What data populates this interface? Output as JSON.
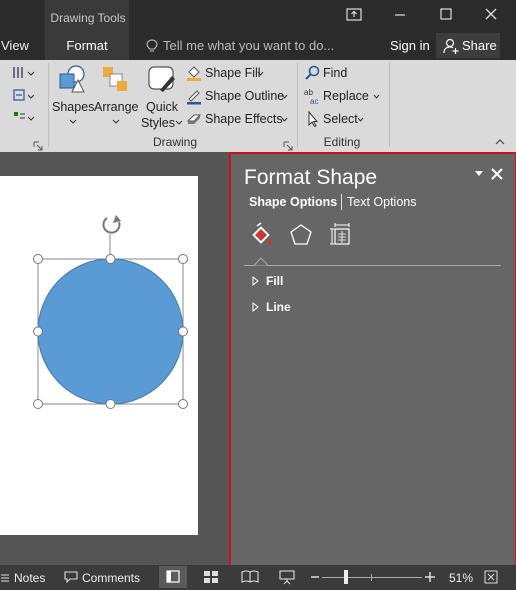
{
  "titlebar": {
    "context_label": "Drawing Tools",
    "tabs": [
      {
        "label": "View"
      },
      {
        "label": "Format"
      }
    ],
    "tell_me_placeholder": "Tell me what you want to do...",
    "sign_in": "Sign in",
    "share": "Share"
  },
  "ribbon": {
    "groups": [
      {
        "label": "Drawing",
        "buttons": [
          {
            "label": "Shapes"
          },
          {
            "label": "Arrange"
          },
          {
            "label_line1": "Quick",
            "label_line2": "Styles"
          }
        ],
        "commands": [
          {
            "label": "Shape Fill"
          },
          {
            "label": "Shape Outline"
          },
          {
            "label": "Shape Effects"
          }
        ]
      },
      {
        "label": "Editing",
        "commands": [
          {
            "label": "Find"
          },
          {
            "label": "Replace"
          },
          {
            "label": "Select"
          }
        ]
      }
    ]
  },
  "pane": {
    "title": "Format Shape",
    "tabs": [
      {
        "label": "Shape Options"
      },
      {
        "label": "Text Options"
      }
    ],
    "sections": [
      {
        "label": "Fill"
      },
      {
        "label": "Line"
      }
    ]
  },
  "status": {
    "notes": "Notes",
    "comments": "Comments",
    "zoom": "51%"
  },
  "shape": {
    "fill": "#5b9bd5",
    "outline": "#4a7fb0"
  },
  "colors": {
    "highlight": "#d0101a",
    "titlebar": "#2b2b2b",
    "ribbon": "#dadada",
    "pane": "#666666"
  }
}
